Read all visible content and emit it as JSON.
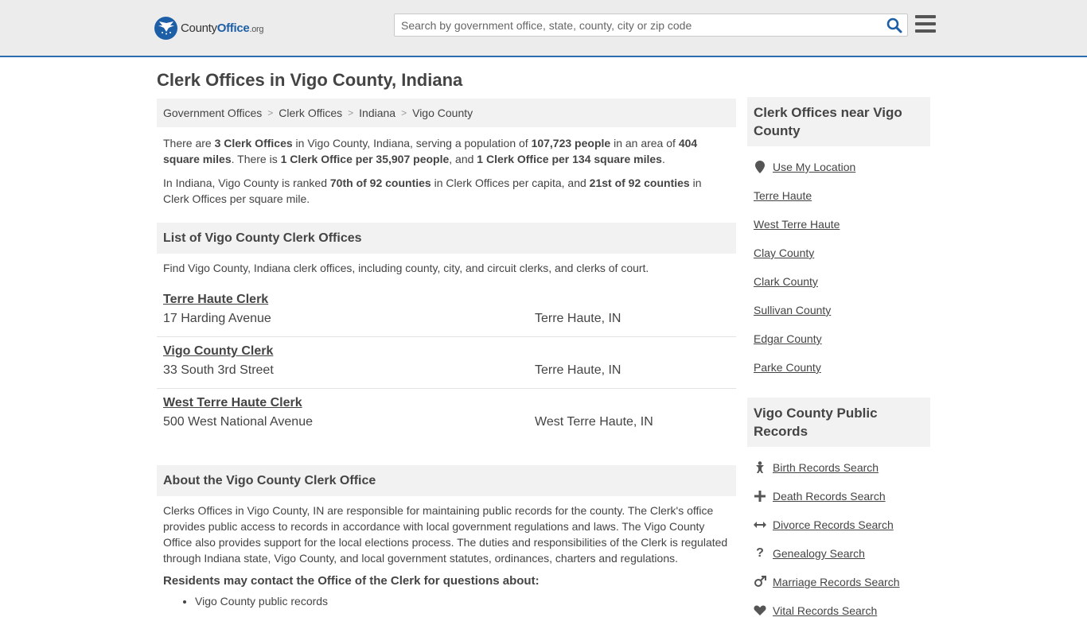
{
  "header": {
    "logo_main": "County",
    "logo_accent": "Office",
    "logo_suffix": ".org",
    "search_placeholder": "Search by government office, state, county, city or zip code"
  },
  "page_title": "Clerk Offices in Vigo County, Indiana",
  "breadcrumb": [
    "Government Offices",
    "Clerk Offices",
    "Indiana",
    "Vigo County"
  ],
  "summary": {
    "p1": [
      {
        "t": "There are ",
        "b": false
      },
      {
        "t": "3 Clerk Offices",
        "b": true
      },
      {
        "t": " in Vigo County, Indiana, serving a population of ",
        "b": false
      },
      {
        "t": "107,723 people",
        "b": true
      },
      {
        "t": " in an area of ",
        "b": false
      },
      {
        "t": "404 square miles",
        "b": true
      },
      {
        "t": ". There is ",
        "b": false
      },
      {
        "t": "1 Clerk Office per 35,907 people",
        "b": true
      },
      {
        "t": ", and ",
        "b": false
      },
      {
        "t": "1 Clerk Office per 134 square miles",
        "b": true
      },
      {
        "t": ".",
        "b": false
      }
    ],
    "p2": [
      {
        "t": "In Indiana, Vigo County is ranked ",
        "b": false
      },
      {
        "t": "70th of 92 counties",
        "b": true
      },
      {
        "t": " in Clerk Offices per capita, and ",
        "b": false
      },
      {
        "t": "21st of 92 counties",
        "b": true
      },
      {
        "t": " in Clerk Offices per square mile.",
        "b": false
      }
    ]
  },
  "list_section": {
    "heading": "List of Vigo County Clerk Offices",
    "intro": "Find Vigo County, Indiana clerk offices, including county, city, and circuit clerks, and clerks of court.",
    "offices": [
      {
        "name": "Terre Haute Clerk",
        "address": "17 Harding Avenue",
        "city": "Terre Haute, IN"
      },
      {
        "name": "Vigo County Clerk",
        "address": "33 South 3rd Street",
        "city": "Terre Haute, IN"
      },
      {
        "name": "West Terre Haute Clerk",
        "address": "500 West National Avenue",
        "city": "West Terre Haute, IN"
      }
    ]
  },
  "about_section": {
    "heading": "About the Vigo County Clerk Office",
    "text": "Clerks Offices in Vigo County, IN are responsible for maintaining public records for the county. The Clerk's office provides public access to records in accordance with local government regulations and laws. The Vigo County Office also provides support for the local elections process. The duties and responsibilities of the Clerk is regulated through Indiana state, Vigo County, and local government statutes, ordinances, charters and regulations.",
    "residents_heading": "Residents may contact the Office of the Clerk for questions about:",
    "bullets": [
      "Vigo County public records"
    ]
  },
  "sidebar": {
    "nearby_heading": "Clerk Offices near Vigo County",
    "nearby": [
      {
        "label": "Use My Location",
        "icon": "map-pin-icon"
      },
      {
        "label": "Terre Haute"
      },
      {
        "label": "West Terre Haute"
      },
      {
        "label": "Clay County"
      },
      {
        "label": "Clark County"
      },
      {
        "label": "Sullivan County"
      },
      {
        "label": "Edgar County"
      },
      {
        "label": "Parke County"
      }
    ],
    "records_heading": "Vigo County Public Records",
    "records": [
      {
        "label": "Birth Records Search",
        "icon": "baby-icon",
        "glyph": "🚼"
      },
      {
        "label": "Death Records Search",
        "icon": "cross-icon",
        "glyph": "✚"
      },
      {
        "label": "Divorce Records Search",
        "icon": "arrows-horizontal-icon",
        "glyph": "↔"
      },
      {
        "label": "Genealogy Search",
        "icon": "question-icon",
        "glyph": "?"
      },
      {
        "label": "Marriage Records Search",
        "icon": "gender-icon",
        "glyph": "⚤"
      },
      {
        "label": "Vital Records Search",
        "icon": "heartbeat-icon",
        "glyph": "♥"
      }
    ]
  }
}
